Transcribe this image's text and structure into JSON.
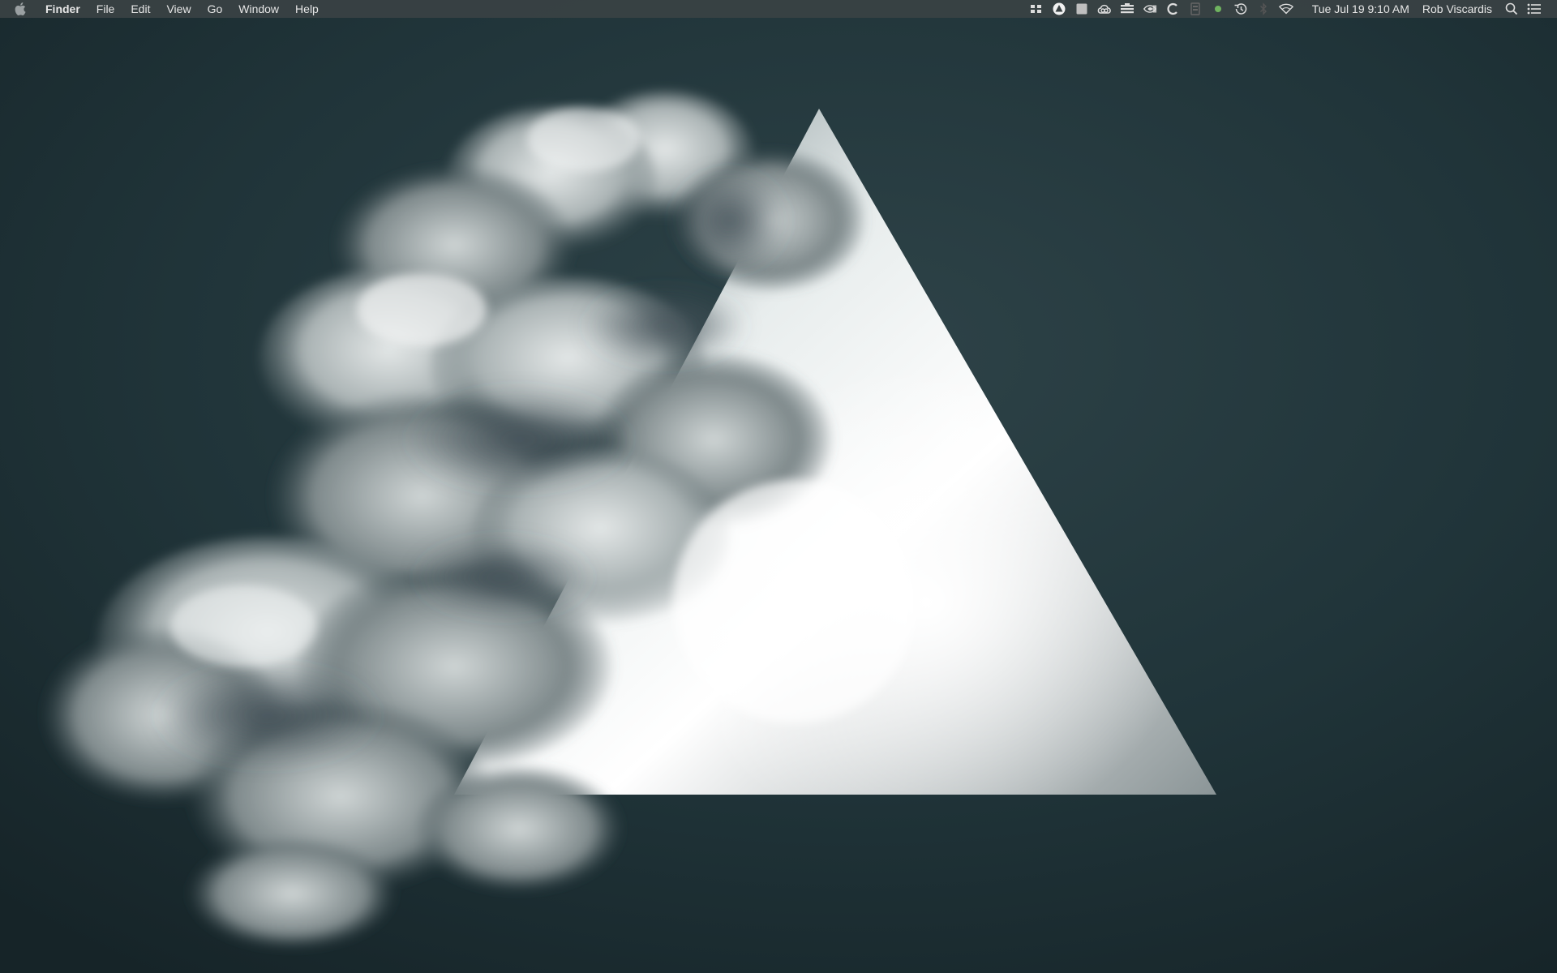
{
  "menubar": {
    "app_name": "Finder",
    "menus": [
      "File",
      "Edit",
      "View",
      "Go",
      "Window",
      "Help"
    ],
    "status_icons": [
      "scissors-grid-icon",
      "triangle-circle-icon",
      "square-icon",
      "creative-cloud-icon",
      "stacked-lines-icon",
      "nvidia-icon",
      "c-letter-icon",
      "battery-status-icon",
      "green-dot-icon",
      "time-machine-icon",
      "bluetooth-icon",
      "wifi-icon"
    ],
    "datetime": "Tue Jul 19  9:10 AM",
    "user": "Rob Viscardis"
  },
  "colors": {
    "menubar_bg": "#3a4244",
    "menubar_text": "#e6e6e6",
    "wallpaper_bg": "#1f3338",
    "accent_green": "#6fb35f"
  }
}
